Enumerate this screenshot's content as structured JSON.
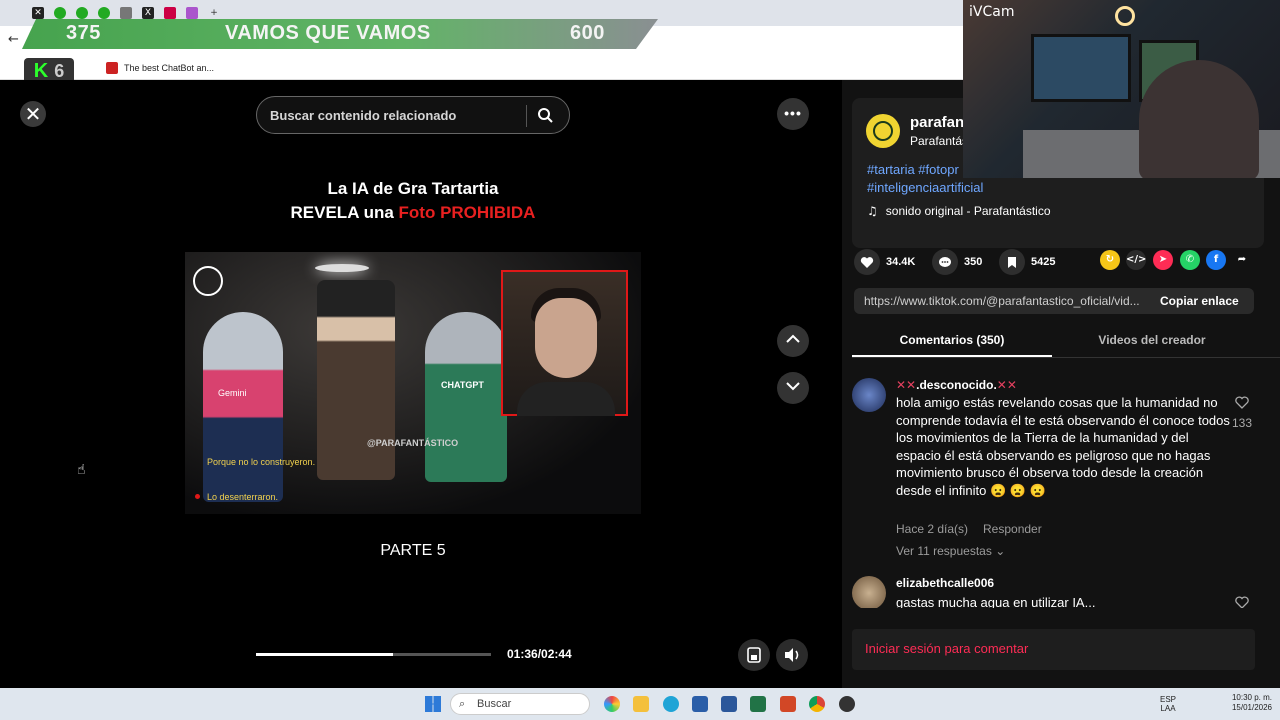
{
  "overlay": {
    "left_count": "375",
    "title": "VAMOS QUE VAMOS",
    "right_count": "600",
    "kick_number": "6"
  },
  "bookmarks": {
    "item": "The best ChatBot an..."
  },
  "webcam": {
    "label": "iVCam"
  },
  "video": {
    "search_placeholder": "Buscar contenido relacionado",
    "title_line1": "La IA de Gra Tartartia",
    "title_line2_white": "REVELA una",
    "title_line2_red": "Foto PROHIBIDA",
    "caption1": "Porque no lo construyeron.",
    "caption2": "Lo desenterraron.",
    "watermark": "@PARAFANTÁSTICO",
    "shirt1": "Gemini",
    "shirt2": "CHATGPT",
    "part_label": "PARTE 5",
    "time": "01:36/02:44",
    "progress": 0.585
  },
  "creator": {
    "username": "parafant",
    "display_name": "Parafantásti",
    "tags_line1": "#tartaria #fotopr",
    "tags_line2": "#inteligenciaartificial",
    "sound": "sonido original - Parafantástico"
  },
  "stats": {
    "likes": "34.4K",
    "comments": "350",
    "saves": "5425"
  },
  "share_colors": [
    "#f5c518",
    "#2b2b2b",
    "#fe2c55",
    "#25d366",
    "#1877f2"
  ],
  "link": {
    "url": "https://www.tiktok.com/@parafantastico_oficial/vid...",
    "copy_label": "Copiar enlace"
  },
  "tabs": {
    "comments": "Comentarios (350)",
    "creator_videos": "Videos del creador"
  },
  "comments": [
    {
      "user": ".desconocido.",
      "text": "hola amigo estás revelando cosas que la humanidad no comprende todavía él te está observando él conoce todos los movimientos de la Tierra de la humanidad y del espacio él está observando es peligroso que no hagas movimiento brusco él observa todo desde la creación desde el infinito 😦 😦 😦",
      "time": "Hace 2 día(s)",
      "reply": "Responder",
      "view_replies": "Ver 11 respuestas",
      "likes": "133"
    },
    {
      "user": "elizabethcalle006",
      "text": "gastas mucha agua en utilizar IA..."
    }
  ],
  "login_prompt": "Iniciar sesión para comentar",
  "taskbar": {
    "search_label": "Buscar",
    "lang_line1": "ESP",
    "lang_line2": "LAA",
    "time": "10:30 p. m.",
    "date": "15/01/2026"
  }
}
